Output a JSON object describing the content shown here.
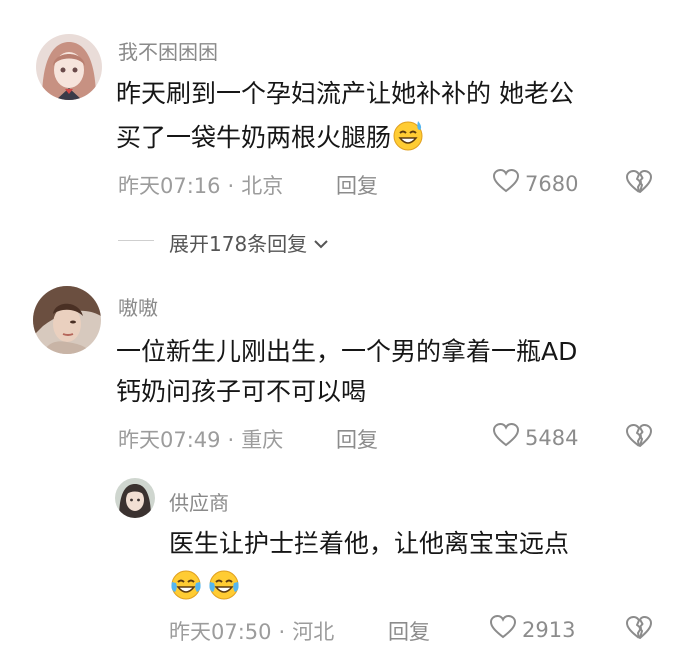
{
  "comments": [
    {
      "username": "我不困困困",
      "text_line1": "昨天刷到一个孕妇流产让她补补的 她老公",
      "text_line2": "买了一袋牛奶两根火腿肠",
      "emoji": "sweat-smile-emoji",
      "time": "昨天07:16",
      "location": "北京",
      "reply_label": "回复",
      "likes": "7680",
      "expand_label": "展开178条回复"
    },
    {
      "username": "嗷嗷",
      "text_line1": "一位新生儿刚出生，一个男的拿着一瓶AD",
      "text_line2": "钙奶问孩子可不可以喝",
      "time": "昨天07:49",
      "location": "重庆",
      "reply_label": "回复",
      "likes": "5484"
    }
  ],
  "reply": {
    "username": "供应商",
    "text_line1": "医生让护士拦着他，让他离宝宝远点",
    "emoji": "tears-of-joy-emoji",
    "time": "昨天07:50",
    "location": "河北",
    "reply_label": "回复",
    "likes": "2913"
  },
  "separator": "·",
  "colors": {
    "text": "#161616",
    "muted": "#9c9c9c",
    "background": "#ffffff"
  },
  "icons": [
    "heart-outline-icon",
    "broken-heart-icon",
    "chevron-down-icon"
  ]
}
